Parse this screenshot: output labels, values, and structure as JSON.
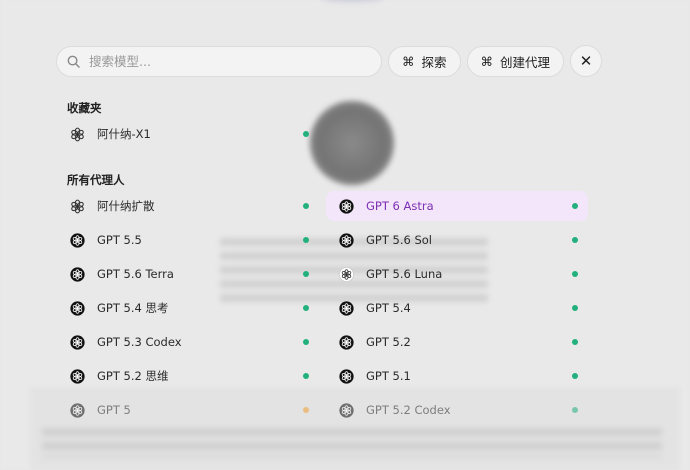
{
  "search": {
    "placeholder": "搜索模型..."
  },
  "buttons": {
    "explore": {
      "shortcut": "⌘",
      "label": "探索"
    },
    "create_agent": {
      "shortcut": "⌘",
      "label": "创建代理"
    },
    "close": "✕"
  },
  "favorites": {
    "title": "收藏夹",
    "items": [
      {
        "label": "阿什纳-X1",
        "icon": "gear-logo-icon",
        "status_color": "#22b07d"
      }
    ]
  },
  "all_agents": {
    "title": "所有代理人",
    "left": [
      {
        "label": "阿什纳扩散",
        "icon": "gear-logo-icon",
        "status_color": "#22b07d"
      },
      {
        "label": "GPT 5.5",
        "icon": "openai-icon",
        "status_color": "#22b07d"
      },
      {
        "label": "GPT 5.6 Terra",
        "icon": "openai-icon",
        "status_color": "#22b07d"
      },
      {
        "label": "GPT 5.4 思考",
        "icon": "openai-icon",
        "status_color": "#22b07d"
      },
      {
        "label": "GPT 5.3 Codex",
        "icon": "openai-icon",
        "status_color": "#22b07d"
      },
      {
        "label": "GPT 5.2 思维",
        "icon": "openai-icon",
        "status_color": "#22b07d"
      },
      {
        "label": "GPT 5",
        "icon": "openai-icon",
        "status_color": "#f0a030"
      }
    ],
    "right": [
      {
        "label": "GPT 6 Astra",
        "icon": "openai-icon",
        "status_color": "#22b07d",
        "selected": true
      },
      {
        "label": "GPT 5.6 Sol",
        "icon": "openai-icon",
        "status_color": "#22b07d"
      },
      {
        "label": "GPT 5.6 Luna",
        "icon": "openai-outline-icon",
        "status_color": "#22b07d"
      },
      {
        "label": "GPT 5.4",
        "icon": "openai-icon",
        "status_color": "#22b07d"
      },
      {
        "label": "GPT 5.2",
        "icon": "openai-icon",
        "status_color": "#22b07d"
      },
      {
        "label": "GPT 5.1",
        "icon": "openai-icon",
        "status_color": "#22b07d"
      },
      {
        "label": "GPT 5.2 Codex",
        "icon": "openai-icon",
        "status_color": "#22b07d"
      }
    ]
  },
  "colors": {
    "accent": "#7d2fb3",
    "selected_bg": "#f3e6fb",
    "online": "#22b07d",
    "warning": "#f0a030"
  }
}
